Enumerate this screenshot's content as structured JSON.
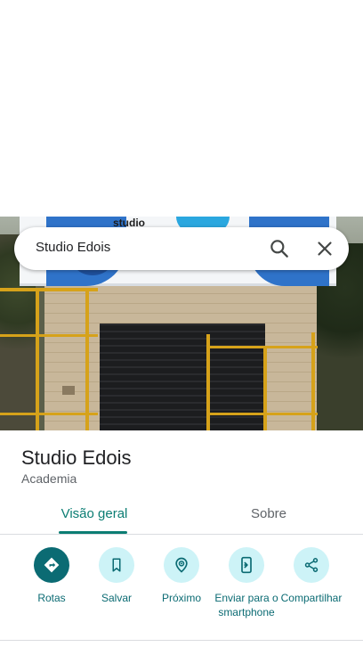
{
  "search": {
    "query": "Studio Edois"
  },
  "place": {
    "name": "Studio Edois",
    "category": "Academia",
    "photo_sign_text": "studio"
  },
  "tabs": [
    {
      "label": "Visão geral",
      "active": true
    },
    {
      "label": "Sobre",
      "active": false
    }
  ],
  "actions": [
    {
      "label": "Rotas",
      "icon": "directions-icon"
    },
    {
      "label": "Salvar",
      "icon": "bookmark-icon"
    },
    {
      "label": "Próximo",
      "icon": "nearby-icon"
    },
    {
      "label": "Enviar para o smartphone",
      "icon": "send-to-phone-icon"
    },
    {
      "label": "Compartilhar",
      "icon": "share-icon"
    }
  ],
  "colors": {
    "accent": "#0b7d73",
    "action_primary": "#0b6b73",
    "action_secondary": "#cdf3f7",
    "text_primary": "#202124",
    "text_secondary": "#5f6368"
  }
}
